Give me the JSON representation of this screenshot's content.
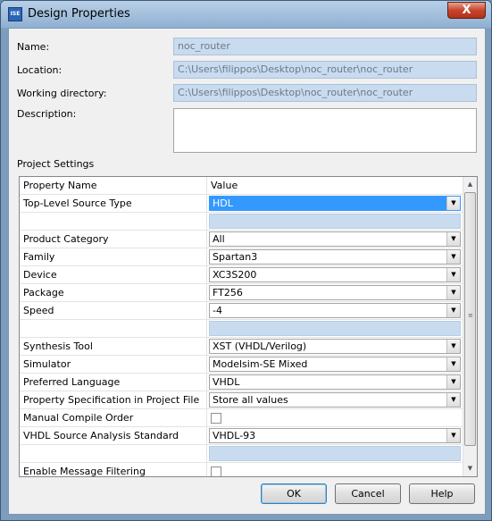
{
  "window": {
    "title": "Design Properties",
    "app_icon_text": "ISE",
    "close_glyph": "X"
  },
  "form": {
    "name_label": "Name:",
    "name_value": "noc_router",
    "location_label": "Location:",
    "location_value": "C:\\Users\\filippos\\Desktop\\noc_router\\noc_router",
    "workdir_label": "Working directory:",
    "workdir_value": "C:\\Users\\filippos\\Desktop\\noc_router\\noc_router",
    "description_label": "Description:",
    "description_value": "",
    "project_settings_label": "Project Settings"
  },
  "grid": {
    "header": {
      "name": "Property Name",
      "value": "Value"
    },
    "rows": [
      {
        "name": "Top-Level Source Type",
        "value": "HDL",
        "type": "combo",
        "selected": true
      },
      {
        "name": "",
        "value": "",
        "type": "blank"
      },
      {
        "name": "Product Category",
        "value": "All",
        "type": "combo"
      },
      {
        "name": "Family",
        "value": "Spartan3",
        "type": "combo"
      },
      {
        "name": "Device",
        "value": "XC3S200",
        "type": "combo"
      },
      {
        "name": "Package",
        "value": "FT256",
        "type": "combo"
      },
      {
        "name": "Speed",
        "value": "-4",
        "type": "combo"
      },
      {
        "name": "",
        "value": "",
        "type": "blank"
      },
      {
        "name": "Synthesis Tool",
        "value": "XST (VHDL/Verilog)",
        "type": "combo"
      },
      {
        "name": "Simulator",
        "value": "Modelsim-SE Mixed",
        "type": "combo"
      },
      {
        "name": "Preferred Language",
        "value": "VHDL",
        "type": "combo"
      },
      {
        "name": "Property Specification in Project File",
        "value": "Store all values",
        "type": "combo"
      },
      {
        "name": "Manual Compile Order",
        "value": "",
        "type": "checkbox"
      },
      {
        "name": "VHDL Source Analysis Standard",
        "value": "VHDL-93",
        "type": "combo"
      },
      {
        "name": "",
        "value": "",
        "type": "blank"
      },
      {
        "name": "Enable Message Filtering",
        "value": "",
        "type": "checkbox"
      }
    ]
  },
  "buttons": {
    "ok": "OK",
    "cancel": "Cancel",
    "help": "Help"
  },
  "colors": {
    "selection": "#3399ff",
    "readonly_field": "#c9dbee",
    "dialog_bg": "#f0f0f0"
  }
}
